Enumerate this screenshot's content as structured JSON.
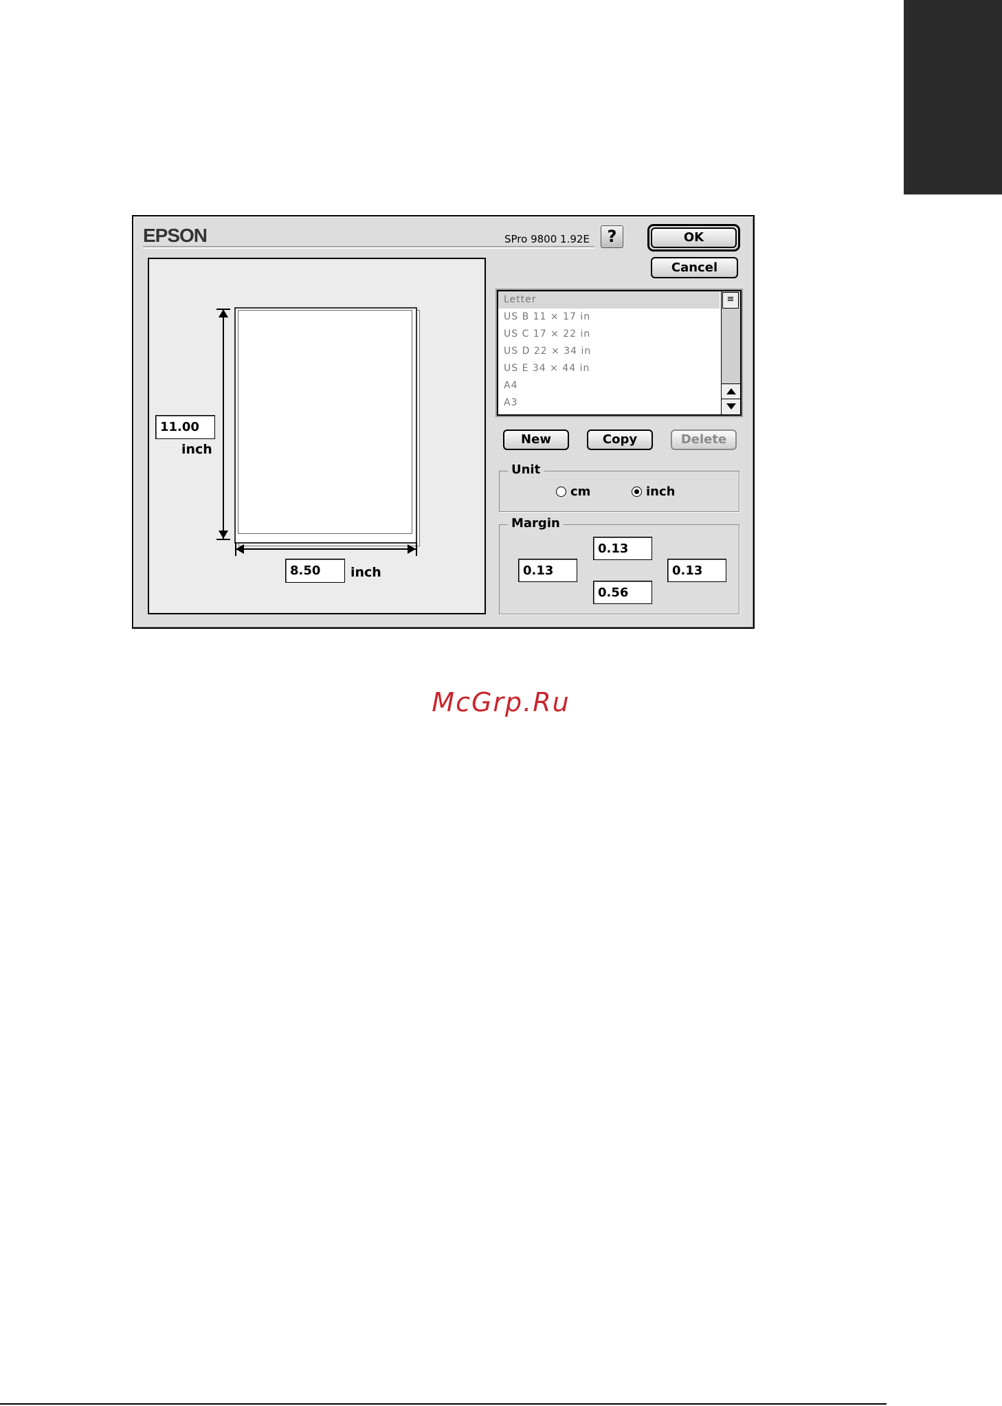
{
  "dialog": {
    "brand": "EPSON",
    "version": "SPro 9800 1.92E",
    "help_label": "?",
    "ok_label": "OK",
    "cancel_label": "Cancel"
  },
  "preview": {
    "height_value": "11.00",
    "height_unit": "inch",
    "width_value": "8.50",
    "width_unit": "inch"
  },
  "paper_list": {
    "items": [
      "Letter",
      "US B 11 × 17 in",
      "US C 17 × 22 in",
      "US D 22 × 34 in",
      "US E 34 × 44 in",
      "A4",
      "A3"
    ],
    "selected_index": 0
  },
  "list_buttons": {
    "new_label": "New",
    "copy_label": "Copy",
    "delete_label": "Delete"
  },
  "unit": {
    "title": "Unit",
    "options": [
      "cm",
      "inch"
    ],
    "selected": "inch"
  },
  "margin": {
    "title": "Margin",
    "top": "0.13",
    "left": "0.13",
    "right": "0.13",
    "bottom": "0.56"
  },
  "watermark": "McGrp.Ru",
  "colors": {
    "dialog_bg": "#dddddd",
    "watermark": "#c8262e",
    "tab_marker": "#2b2b2b"
  }
}
